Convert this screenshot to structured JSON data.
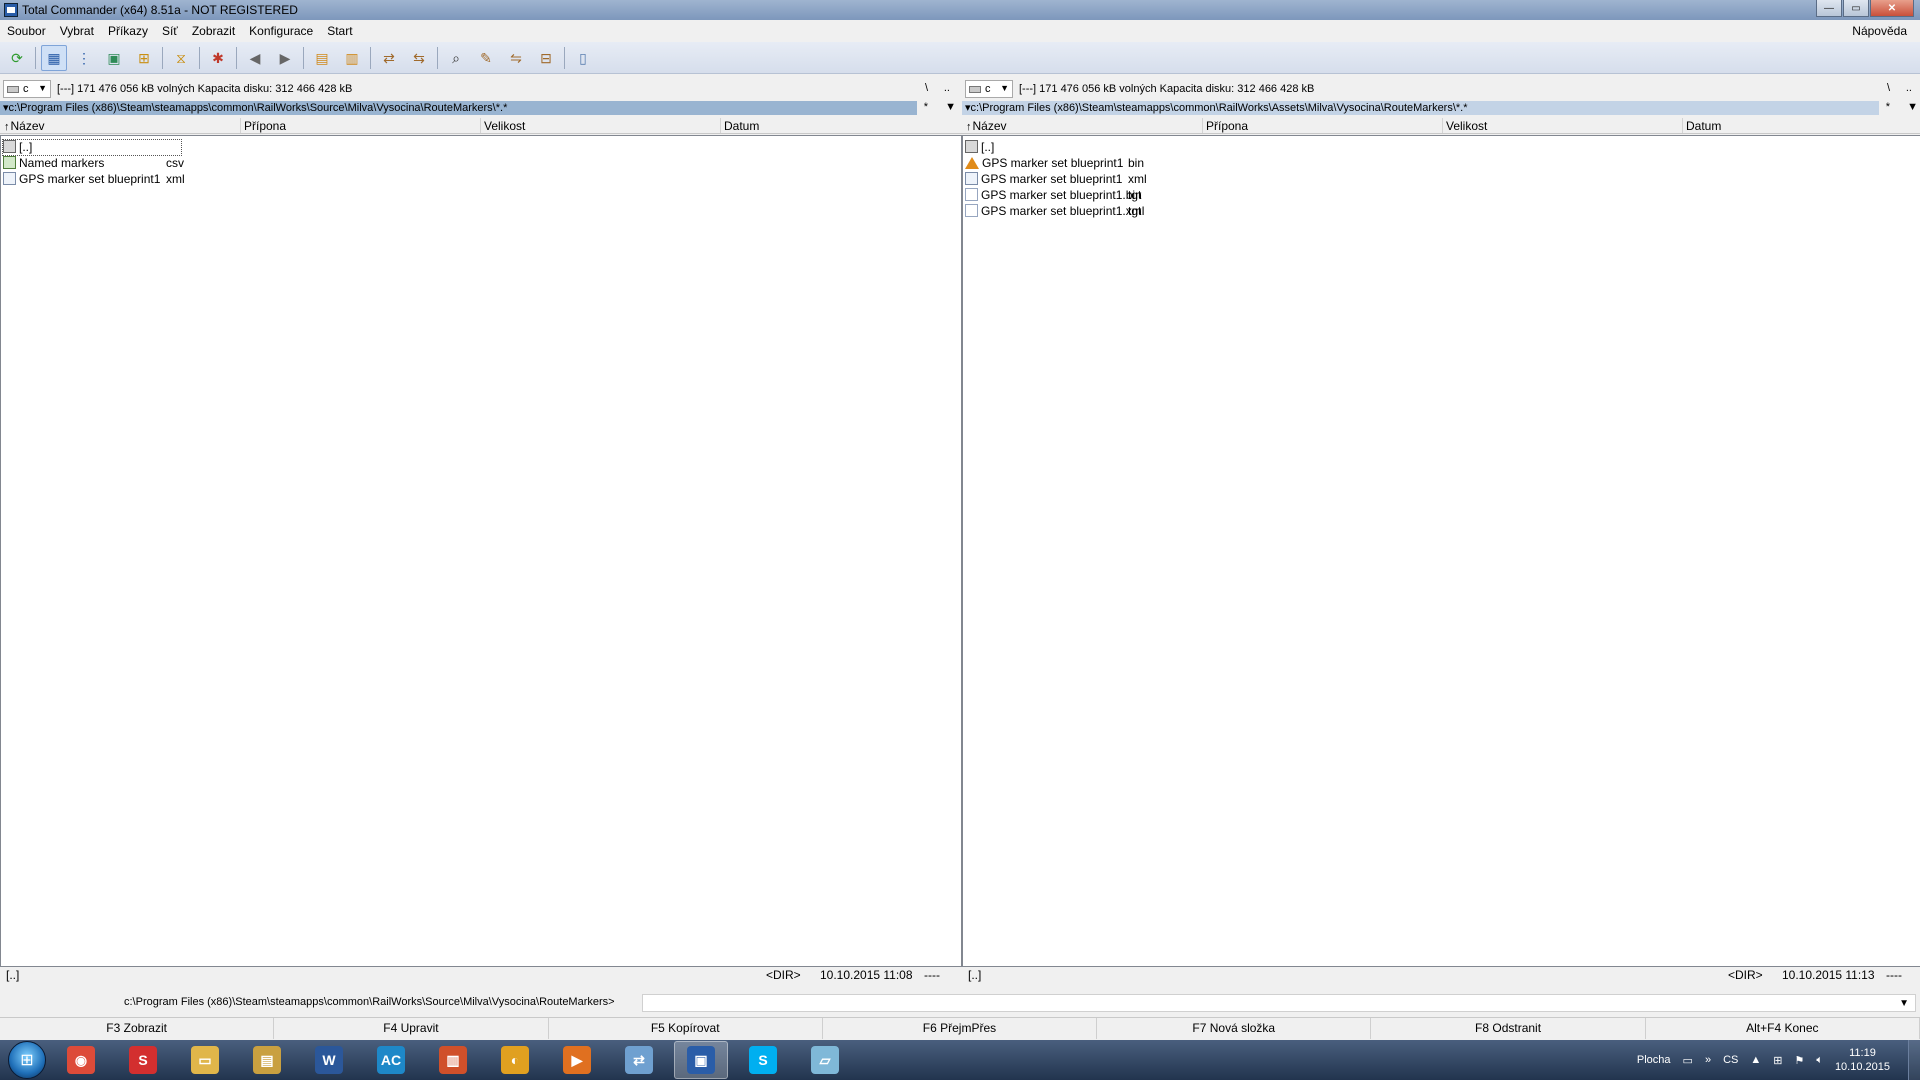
{
  "window": {
    "title": "Total Commander (x64) 8.51a - NOT REGISTERED",
    "min_glyph": "—",
    "max_glyph": "▭",
    "close_glyph": "✕"
  },
  "menu": {
    "items": [
      "Soubor",
      "Vybrat",
      "Příkazy",
      "Síť",
      "Zobrazit",
      "Konfigurace",
      "Start"
    ],
    "help": "Nápověda"
  },
  "toolbar": {
    "buttons": [
      {
        "icon": "refresh-icon",
        "glyph": "⟳",
        "color": "#2e9b2e"
      },
      {
        "icon": "brief-view-icon",
        "glyph": "▦",
        "color": "#2a5da8"
      },
      {
        "icon": "detailed-view-icon",
        "glyph": "⋮",
        "color": "#2a5da8"
      },
      {
        "icon": "thumbnail-view-icon",
        "glyph": "▣",
        "color": "#2e8b57"
      },
      {
        "icon": "tree-view-icon",
        "glyph": "⊞",
        "color": "#c98f12"
      },
      {
        "icon": "filter-icon",
        "glyph": "⧖",
        "color": "#c98f12"
      },
      {
        "icon": "invert-selection-icon",
        "glyph": "✱",
        "color": "#c0392b"
      },
      {
        "icon": "back-icon",
        "glyph": "◀",
        "color": "#666666"
      },
      {
        "icon": "forward-icon",
        "glyph": "▶",
        "color": "#666666"
      },
      {
        "icon": "pack-icon",
        "glyph": "▤",
        "color": "#d08a1c"
      },
      {
        "icon": "unpack-icon",
        "glyph": "▥",
        "color": "#d08a1c"
      },
      {
        "icon": "ftp-connect-icon",
        "glyph": "⇄",
        "color": "#a06a2c"
      },
      {
        "icon": "url-ftp-icon",
        "glyph": "⇆",
        "color": "#a06a2c"
      },
      {
        "icon": "search-icon",
        "glyph": "⌕",
        "color": "#333333"
      },
      {
        "icon": "multi-rename-icon",
        "glyph": "✎",
        "color": "#a06a2c"
      },
      {
        "icon": "sync-dirs-icon",
        "glyph": "⇋",
        "color": "#a06a2c"
      },
      {
        "icon": "compare-files-icon",
        "glyph": "⊟",
        "color": "#a06a2c"
      },
      {
        "icon": "notepad-icon",
        "glyph": "▯",
        "color": "#5a7fb0"
      }
    ]
  },
  "left_panel": {
    "drive": "c",
    "drive_info": "[---]  171 476 056 kB volných   Kapacita disku: 312 466 428 kB",
    "root_btn": "\\",
    "up_btn": "..",
    "path": "c:\\Program Files (x86)\\Steam\\steamapps\\common\\RailWorks\\Source\\Milva\\Vysocina\\RouteMarkers\\*.*",
    "path_star": "*",
    "path_arrow": "▼",
    "columns": [
      "Název",
      "Přípona",
      "Velikost",
      "Datum"
    ],
    "files": [
      {
        "name": "[..]",
        "ext": "",
        "icon": "up"
      },
      {
        "name": "Named markers",
        "ext": "csv",
        "icon": "csv"
      },
      {
        "name": "GPS marker set blueprint1",
        "ext": "xml",
        "icon": "xml"
      }
    ],
    "status": {
      "left": "[..]",
      "dir": "<DIR>",
      "date": "10.10.2015 11:08",
      "attr": "----"
    }
  },
  "right_panel": {
    "drive": "c",
    "drive_info": "[---]  171 476 056 kB volných   Kapacita disku: 312 466 428 kB",
    "root_btn": "\\",
    "up_btn": "..",
    "path": "c:\\Program Files (x86)\\Steam\\steamapps\\common\\RailWorks\\Assets\\Milva\\Vysocina\\RouteMarkers\\*.*",
    "path_star": "*",
    "path_arrow": "▼",
    "columns": [
      "Název",
      "Přípona",
      "Velikost",
      "Datum"
    ],
    "files": [
      {
        "name": "[..]",
        "ext": "",
        "icon": "up"
      },
      {
        "name": "GPS marker set blueprint1",
        "ext": "bin",
        "icon": "bin"
      },
      {
        "name": "GPS marker set blueprint1",
        "ext": "xml",
        "icon": "xml"
      },
      {
        "name": "GPS marker set blueprint1.bin",
        "ext": "tgt",
        "icon": "tgt"
      },
      {
        "name": "GPS marker set blueprint1.xml",
        "ext": "tgt",
        "icon": "tgt"
      }
    ],
    "status": {
      "left": "[..]",
      "dir": "<DIR>",
      "date": "10.10.2015 11:13",
      "attr": "----"
    }
  },
  "command_line": {
    "path": "c:\\Program Files (x86)\\Steam\\steamapps\\common\\RailWorks\\Source\\Milva\\Vysocina\\RouteMarkers>",
    "value": "",
    "arrow": "▼"
  },
  "function_keys": [
    "F3 Zobrazit",
    "F4 Upravit",
    "F5 Kopírovat",
    "F6 PřejmPřes",
    "F7 Nová složka",
    "F8 Odstranit",
    "Alt+F4 Konec"
  ],
  "taskbar": {
    "start_glyph": "⊞",
    "apps": [
      {
        "icon": "chrome-icon",
        "glyph": "◉",
        "color": "#dd4b39",
        "active": false
      },
      {
        "icon": "s-app-icon",
        "glyph": "S",
        "color": "#d32f2f",
        "active": false
      },
      {
        "icon": "explorer-icon",
        "glyph": "▭",
        "color": "#e0b64a",
        "active": false
      },
      {
        "icon": "file-manager-icon",
        "glyph": "▤",
        "color": "#c9a040",
        "active": false
      },
      {
        "icon": "word-icon",
        "glyph": "W",
        "color": "#2b579a",
        "active": false
      },
      {
        "icon": "ac-app-icon",
        "glyph": "AC",
        "color": "#1e88c8",
        "active": false
      },
      {
        "icon": "tools-app-icon",
        "glyph": "▥",
        "color": "#d0502a",
        "active": false
      },
      {
        "icon": "headphones-app-icon",
        "glyph": "◐",
        "color": "#e0a020",
        "active": false
      },
      {
        "icon": "media-player-icon",
        "glyph": "▶",
        "color": "#e07020",
        "active": false
      },
      {
        "icon": "network-app-icon",
        "glyph": "⇄",
        "color": "#6fa0d0",
        "active": false
      },
      {
        "icon": "total-commander-icon",
        "glyph": "▣",
        "color": "#2a5da8",
        "active": true
      },
      {
        "icon": "skype-icon",
        "glyph": "S",
        "color": "#00aff0",
        "active": false
      },
      {
        "icon": "notepad-app-icon",
        "glyph": "▱",
        "color": "#7fb8d8",
        "active": false
      }
    ],
    "tray": {
      "desktop_label": "Plocha",
      "lang": "CS",
      "time": "11:19",
      "date": "10.10.2015"
    }
  }
}
